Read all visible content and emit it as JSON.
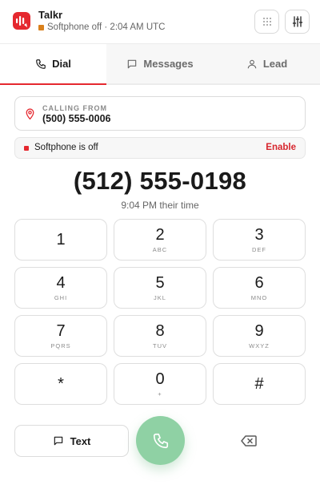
{
  "header": {
    "app_title": "Talkr",
    "status_text": "Softphone off · 2:04 AM UTC",
    "status_color": "#d9801c",
    "logo_icon": "talkr-logo-icon",
    "grid_icon": "dialpad-grid-icon",
    "settings_icon": "sliders-icon"
  },
  "tabs": [
    {
      "label": "Dial",
      "icon": "phone-icon",
      "active": true
    },
    {
      "label": "Messages",
      "icon": "message-icon",
      "active": false
    },
    {
      "label": "Lead",
      "icon": "user-icon",
      "active": false
    }
  ],
  "calling_from": {
    "label": "CALLING FROM",
    "number": "(500) 555-0006",
    "icon": "location-pin-icon"
  },
  "softphone": {
    "status": "Softphone is off",
    "action": "Enable"
  },
  "dialed": {
    "number": "(512) 555-0198",
    "their_time": "9:04 PM their time"
  },
  "keypad": [
    {
      "digit": "1",
      "letters": ""
    },
    {
      "digit": "2",
      "letters": "ABC"
    },
    {
      "digit": "3",
      "letters": "DEF"
    },
    {
      "digit": "4",
      "letters": "GHI"
    },
    {
      "digit": "5",
      "letters": "JKL"
    },
    {
      "digit": "6",
      "letters": "MNO"
    },
    {
      "digit": "7",
      "letters": "PQRS"
    },
    {
      "digit": "8",
      "letters": "TUV"
    },
    {
      "digit": "9",
      "letters": "WXYZ"
    },
    {
      "digit": "*",
      "letters": ""
    },
    {
      "digit": "0",
      "letters": "+"
    },
    {
      "digit": "#",
      "letters": ""
    }
  ],
  "actions": {
    "text_label": "Text",
    "call_icon": "phone-call-icon",
    "backspace_icon": "backspace-icon"
  },
  "colors": {
    "brand": "#e5282f",
    "call_button": "#8fd1a4"
  }
}
